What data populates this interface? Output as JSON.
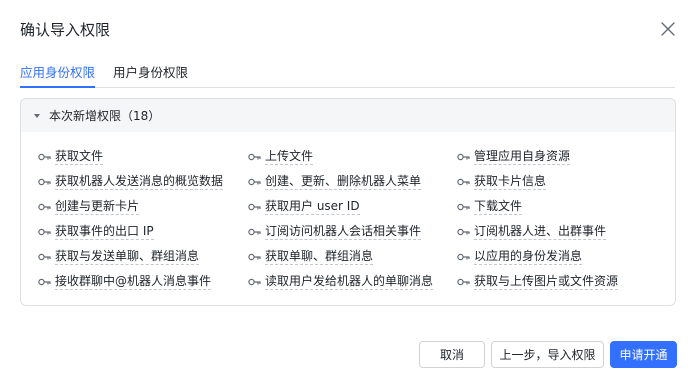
{
  "dialog": {
    "title": "确认导入权限"
  },
  "tabs": [
    {
      "label": "应用身份权限",
      "active": true
    },
    {
      "label": "用户身份权限",
      "active": false
    }
  ],
  "section": {
    "header": "本次新增权限（18）",
    "expanded": true
  },
  "permissions": [
    [
      "获取文件",
      "上传文件",
      "管理应用自身资源"
    ],
    [
      "获取机器人发送消息的概览数据",
      "创建、更新、删除机器人菜单",
      "获取卡片信息"
    ],
    [
      "创建与更新卡片",
      "获取用户 user ID",
      "下载文件"
    ],
    [
      "获取事件的出口 IP",
      "订阅访问机器人会话相关事件",
      "订阅机器人进、出群事件"
    ],
    [
      "获取与发送单聊、群组消息",
      "获取单聊、群组消息",
      "以应用的身份发消息"
    ],
    [
      "接收群聊中@机器人消息事件",
      "读取用户发给机器人的单聊消息",
      "获取与上传图片或文件资源"
    ]
  ],
  "footer": {
    "cancel_label": "取消",
    "prev_label": "上一步，导入权限",
    "submit_label": "申请开通"
  },
  "colors": {
    "accent": "#3370ff",
    "text": "#1f2329",
    "border": "#dee0e3",
    "header_bg": "#f5f6f7"
  },
  "icons": {
    "permission": "key-icon",
    "close": "close-icon",
    "collapse": "caret-down-icon"
  }
}
